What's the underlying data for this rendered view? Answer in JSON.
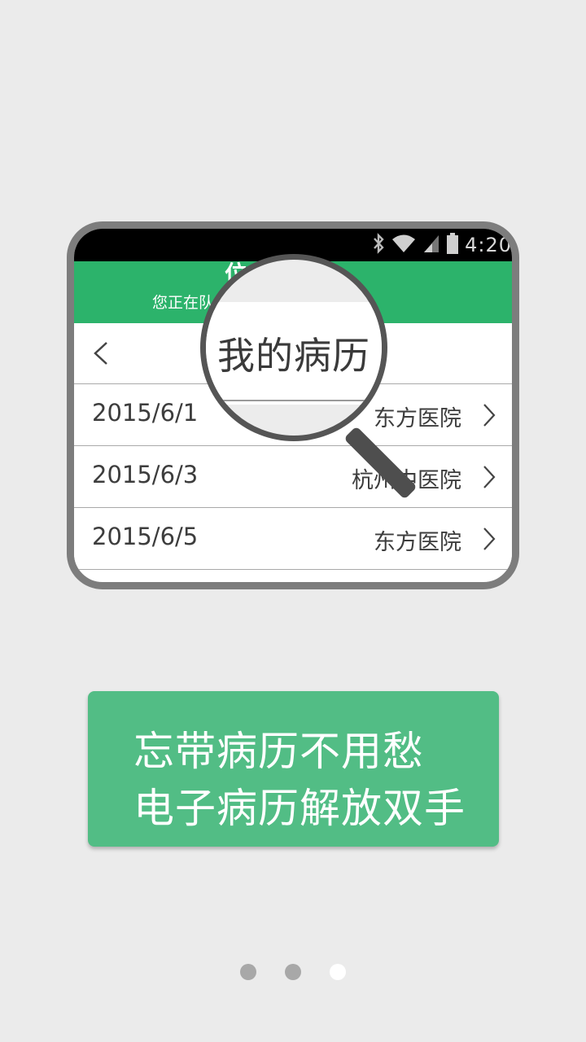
{
  "mockup": {
    "status_time": "4:20",
    "header_partial": "位，",
    "header_sub": "您正在队……待 10 分钟",
    "nav_title": "我的病历",
    "records": [
      {
        "date": "2015/6/1",
        "hospital": "东方医院"
      },
      {
        "date": "2015/6/3",
        "hospital": "杭州中医院"
      },
      {
        "date": "2015/6/5",
        "hospital": "东方医院"
      }
    ]
  },
  "slogan": {
    "line1": "忘带病历不用愁",
    "line2": "电子病历解放双手"
  },
  "pager": {
    "count": 3,
    "active_index": 2
  },
  "colors": {
    "background": "#ebebeb",
    "green_bar": "#2cb36b",
    "slogan_box": "#52bd85",
    "dot_inactive": "#a8a8a8",
    "dot_active": "#ffffff"
  },
  "icons": [
    "bluetooth-icon",
    "wifi-icon",
    "signal-icon",
    "battery-icon",
    "back-chevron-icon",
    "chevron-right-icon",
    "magnifier-icon"
  ]
}
